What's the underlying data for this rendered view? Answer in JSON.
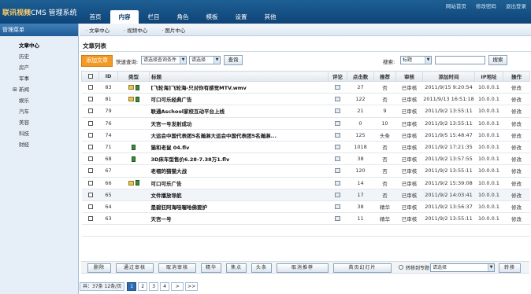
{
  "header": {
    "logo_brand": "联讯视频",
    "logo_rest": "CMS 管理系统",
    "links": [
      "网站首页",
      "修改密码",
      "退出登录"
    ]
  },
  "nav": {
    "tabs": [
      "首页",
      "内容",
      "栏目",
      "角色",
      "模板",
      "设置",
      "其他"
    ],
    "active_index": 1
  },
  "sidebar": {
    "title": "管理菜单",
    "items": [
      "文章中心",
      "历史",
      "房产",
      "军事",
      "新闻",
      "娱乐",
      "汽车",
      "美容",
      "科技",
      "财经"
    ],
    "expander": "⊞"
  },
  "subnav": {
    "items": [
      "· 文章中心",
      "· 视频中心",
      "· 图片中心"
    ]
  },
  "main": {
    "list_title": "文章列表",
    "add_button": "添加文章",
    "quick_query_label": "快速查询:",
    "query_condition_select": "请选择查询条件",
    "category_select": "请选择",
    "query_button": "查询",
    "search_label": "搜索:",
    "search_field_select": "标题",
    "search_keyword_value": "",
    "search_button": "搜索"
  },
  "table": {
    "columns": [
      "",
      "ID",
      "类型",
      "标题",
      "评论",
      "点击数",
      "推荐",
      "审核",
      "添加时间",
      "IP地址",
      "操作"
    ],
    "rows": [
      {
        "id": "83",
        "type": "pic+video",
        "title": "[飞轮海]飞轮海-只对你有感觉MTV.wmv",
        "clicks": "27",
        "recommend": "否",
        "audit": "已审核",
        "time": "2011/9/15 9:20:54",
        "ip": "10.0.0.1",
        "op": "修改"
      },
      {
        "id": "81",
        "type": "pic+video",
        "title": "可口可乐经典广告",
        "clicks": "122",
        "recommend": "否",
        "audit": "已审核",
        "time": "2011/9/13 16:51:18",
        "ip": "10.0.0.1",
        "op": "修改"
      },
      {
        "id": "79",
        "type": "",
        "title": "联通Aschool家校互动平台上线",
        "clicks": "21",
        "recommend": "9",
        "audit": "已审核",
        "time": "2011/9/2 13:55:11",
        "ip": "10.0.0.1",
        "op": "修改"
      },
      {
        "id": "76",
        "type": "",
        "title": "天宫一号发射成功",
        "clicks": "0",
        "recommend": "10",
        "audit": "已审核",
        "time": "2011/9/2 13:55:11",
        "ip": "10.0.0.1",
        "op": "修改"
      },
      {
        "id": "74",
        "type": "",
        "title": "大运会中国代表团5名瀚淋大运会中国代表团5名瀚淋...",
        "clicks": "125",
        "recommend": "头条",
        "audit": "已审核",
        "time": "2011/9/5 15:48:47",
        "ip": "10.0.0.1",
        "op": "修改"
      },
      {
        "id": "71",
        "type": "video",
        "title": "猫和老鼠 04.flv",
        "clicks": "1018",
        "recommend": "否",
        "audit": "已审核",
        "time": "2011/9/2 17:21:35",
        "ip": "10.0.0.1",
        "op": "修改"
      },
      {
        "id": "68",
        "type": "video",
        "title": "3D床车型售价6.28-7.38万1.flv",
        "clicks": "38",
        "recommend": "否",
        "audit": "已审核",
        "time": "2011/9/2 13:57:55",
        "ip": "10.0.0.1",
        "op": "修改"
      },
      {
        "id": "67",
        "type": "",
        "title": "老褶的猫猫大战",
        "clicks": "120",
        "recommend": "否",
        "audit": "已审核",
        "time": "2011/9/2 13:55:11",
        "ip": "10.0.0.1",
        "op": "修改"
      },
      {
        "id": "66",
        "type": "pic+video",
        "title": "可口可乐广告",
        "clicks": "14",
        "recommend": "否",
        "audit": "已审核",
        "time": "2011/9/2 15:39:08",
        "ip": "10.0.0.1",
        "op": "修改"
      },
      {
        "id": "65",
        "type": "",
        "title": "文件播放导航",
        "clicks": "17",
        "recommend": "否",
        "audit": "已审核",
        "time": "2011/9/2 14:03:41",
        "ip": "10.0.0.1",
        "op": "修改"
      },
      {
        "id": "64",
        "type": "",
        "title": "是碧狂阿海哇喔哈佛要护",
        "clicks": "38",
        "recommend": "精华",
        "audit": "已审核",
        "time": "2011/9/2 13:56:37",
        "ip": "10.0.0.1",
        "op": "修改"
      },
      {
        "id": "63",
        "type": "",
        "title": "天宫一号",
        "clicks": "11",
        "recommend": "精华",
        "audit": "已审核",
        "time": "2011/9/2 13:55:11",
        "ip": "10.0.0.1",
        "op": "修改"
      }
    ]
  },
  "batch": {
    "buttons": [
      "删除",
      "通过审核",
      "取消审核",
      "精华",
      "焦点",
      "头条",
      "取消推荐",
      "首页幻灯片"
    ],
    "move_label": "转移到专题",
    "move_select": "请选择",
    "move_button": "转移"
  },
  "pager": {
    "total": "共：37条  12条/页",
    "pages": [
      "1",
      "2",
      "3",
      "4",
      ">",
      ">>"
    ],
    "current": "1"
  },
  "colors": {
    "header_blue": "#0f4478",
    "accent_orange": "#f39a24",
    "red_text": "#c40000"
  }
}
